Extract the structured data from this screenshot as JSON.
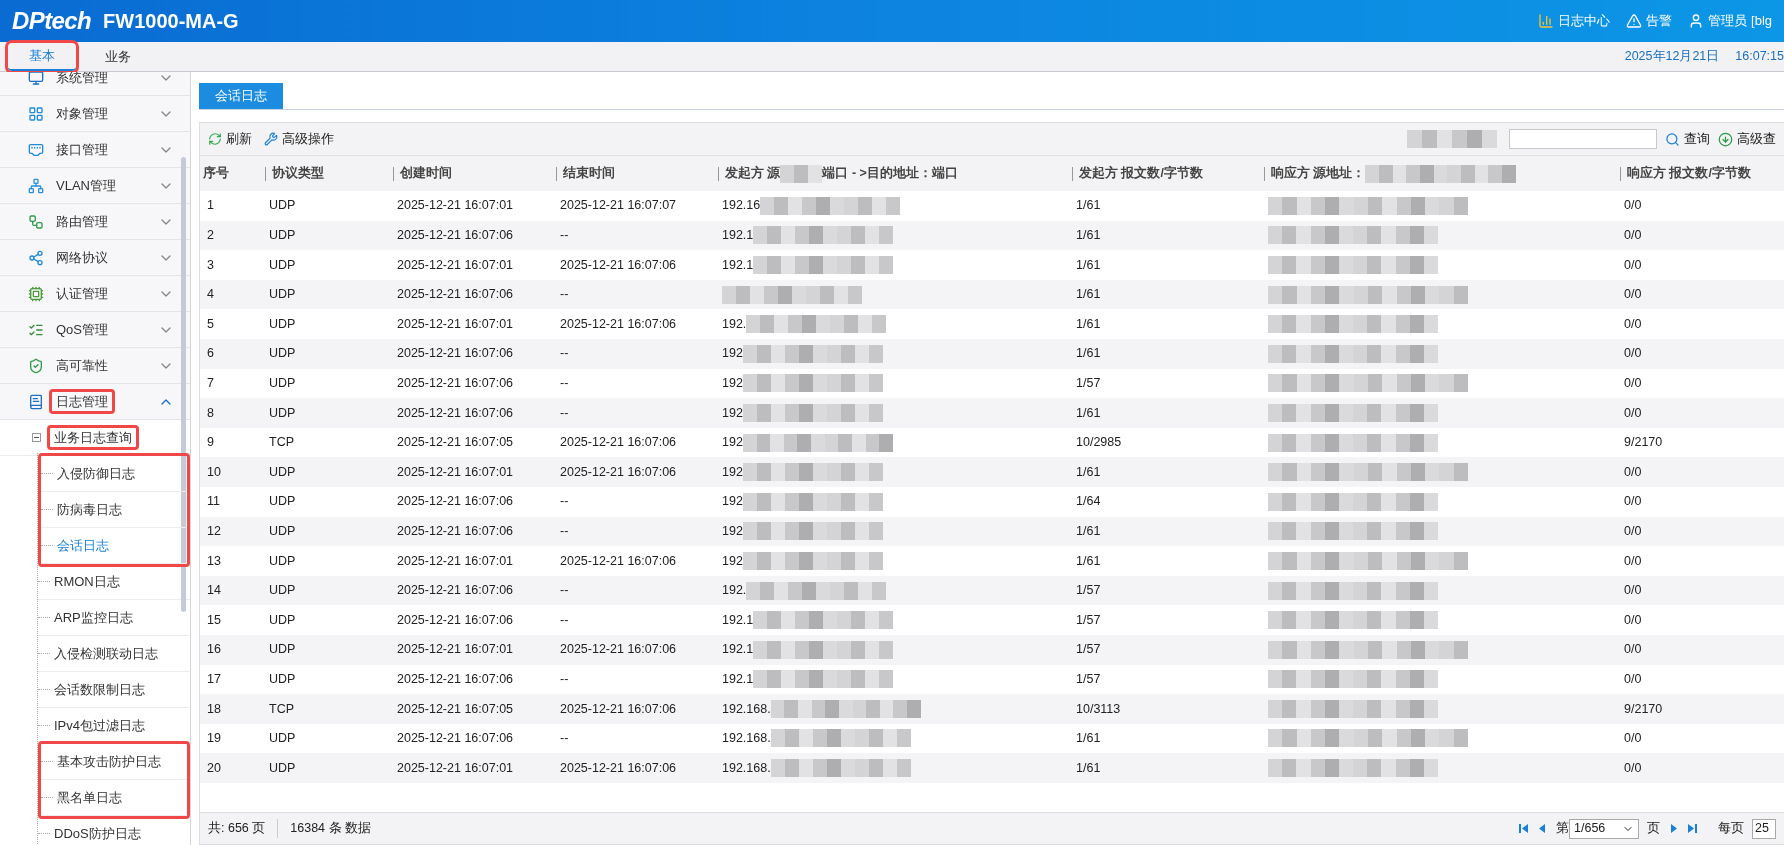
{
  "header": {
    "logo": "DPtech",
    "title": "FW1000-MA-G",
    "actions": [
      {
        "kind": "log",
        "label": "日志中心"
      },
      {
        "kind": "alarm",
        "label": "告警"
      },
      {
        "kind": "user",
        "label": "管理员 [blg"
      }
    ]
  },
  "top_tabs": [
    {
      "label": "基本",
      "selected": true,
      "highlighted": true
    },
    {
      "label": "业务",
      "selected": false,
      "highlighted": false
    }
  ],
  "datetime": {
    "date": "2025年12月21日",
    "time": "16:07:15"
  },
  "sidebar": {
    "items": [
      {
        "kind": "monitor",
        "label": "系统管理",
        "expanded": false,
        "highlighted": false
      },
      {
        "kind": "grid",
        "label": "对象管理",
        "expanded": false,
        "highlighted": false
      },
      {
        "kind": "port",
        "label": "接口管理",
        "expanded": false,
        "highlighted": false
      },
      {
        "kind": "vlan",
        "label": "VLAN管理",
        "expanded": false,
        "highlighted": false
      },
      {
        "kind": "route",
        "label": "路由管理",
        "expanded": false,
        "highlighted": false
      },
      {
        "kind": "network",
        "label": "网络协议",
        "expanded": false,
        "highlighted": false
      },
      {
        "kind": "auth",
        "label": "认证管理",
        "expanded": false,
        "highlighted": false
      },
      {
        "kind": "qos",
        "label": "QoS管理",
        "expanded": false,
        "highlighted": false
      },
      {
        "kind": "shield",
        "label": "高可靠性",
        "expanded": false,
        "highlighted": false
      },
      {
        "kind": "log",
        "label": "日志管理",
        "expanded": true,
        "highlighted": true,
        "children": [
          {
            "label": "业务日志查询",
            "expanded": true,
            "highlighted": true,
            "children": [
              {
                "label": "入侵防御日志",
                "selected": false,
                "highlighted": true
              },
              {
                "label": "防病毒日志",
                "selected": false,
                "highlighted": true
              },
              {
                "label": "会话日志",
                "selected": true,
                "highlighted": true
              },
              {
                "label": "RMON日志",
                "selected": false,
                "highlighted": false
              },
              {
                "label": "ARP监控日志",
                "selected": false,
                "highlighted": false
              },
              {
                "label": "入侵检测联动日志",
                "selected": false,
                "highlighted": false
              },
              {
                "label": "会话数限制日志",
                "selected": false,
                "highlighted": false
              },
              {
                "label": "IPv4包过滤日志",
                "selected": false,
                "highlighted": false
              },
              {
                "label": "基本攻击防护日志",
                "selected": false,
                "highlighted": true
              },
              {
                "label": "黑名单日志",
                "selected": false,
                "highlighted": true
              },
              {
                "label": "DDoS防护日志",
                "selected": false,
                "highlighted": false
              }
            ]
          }
        ]
      }
    ]
  },
  "page_tab": {
    "label": "会话日志",
    "selected": true
  },
  "toolbar": {
    "refresh": "刷新",
    "advanced_ops": "高级操作",
    "search_button": "查询",
    "advanced_search": "高级查"
  },
  "table": {
    "columns": [
      {
        "label": "序号"
      },
      {
        "label": "协议类型"
      },
      {
        "label": "创建时间"
      },
      {
        "label": "结束时间"
      },
      {
        "label": "发起方 源",
        "label_end": "端口 - >目的地址：端口"
      },
      {
        "label": "发起方 报文数/字节数"
      },
      {
        "label": "响应方 源地址："
      },
      {
        "label": "响应方 报文数/字节数"
      }
    ],
    "rows": [
      {
        "no": "1",
        "protocol": "UDP",
        "created": "2025-12-21 16:07:01",
        "ended": "2025-12-21 16:07:07",
        "initiator": "192.16",
        "initiator_counts": "1/61",
        "responder_counts": "0/0"
      },
      {
        "no": "2",
        "protocol": "UDP",
        "created": "2025-12-21 16:07:06",
        "ended": "--",
        "initiator": "192.1",
        "initiator_counts": "1/61",
        "responder_counts": "0/0"
      },
      {
        "no": "3",
        "protocol": "UDP",
        "created": "2025-12-21 16:07:01",
        "ended": "2025-12-21 16:07:06",
        "initiator": "192.1",
        "initiator_counts": "1/61",
        "responder_counts": "0/0"
      },
      {
        "no": "4",
        "protocol": "UDP",
        "created": "2025-12-21 16:07:06",
        "ended": "--",
        "initiator_counts": "1/61",
        "responder_counts": "0/0"
      },
      {
        "no": "5",
        "protocol": "UDP",
        "created": "2025-12-21 16:07:01",
        "ended": "2025-12-21 16:07:06",
        "initiator": "192.",
        "initiator_counts": "1/61",
        "responder_counts": "0/0"
      },
      {
        "no": "6",
        "protocol": "UDP",
        "created": "2025-12-21 16:07:06",
        "ended": "--",
        "initiator": "192",
        "initiator_counts": "1/61",
        "responder_counts": "0/0"
      },
      {
        "no": "7",
        "protocol": "UDP",
        "created": "2025-12-21 16:07:06",
        "ended": "--",
        "initiator": "192",
        "initiator_counts": "1/57",
        "responder_counts": "0/0"
      },
      {
        "no": "8",
        "protocol": "UDP",
        "created": "2025-12-21 16:07:06",
        "ended": "--",
        "initiator": "192",
        "initiator_counts": "1/61",
        "responder_counts": "0/0"
      },
      {
        "no": "9",
        "protocol": "TCP",
        "created": "2025-12-21 16:07:05",
        "ended": "2025-12-21 16:07:06",
        "initiator": "192",
        "initiator_counts": "10/2985",
        "responder_counts": "9/2170"
      },
      {
        "no": "10",
        "protocol": "UDP",
        "created": "2025-12-21 16:07:01",
        "ended": "2025-12-21 16:07:06",
        "initiator": "192",
        "initiator_counts": "1/61",
        "responder_counts": "0/0"
      },
      {
        "no": "11",
        "protocol": "UDP",
        "created": "2025-12-21 16:07:06",
        "ended": "--",
        "initiator": "192",
        "initiator_counts": "1/64",
        "responder_counts": "0/0"
      },
      {
        "no": "12",
        "protocol": "UDP",
        "created": "2025-12-21 16:07:06",
        "ended": "--",
        "initiator": "192",
        "initiator_counts": "1/61",
        "responder_counts": "0/0"
      },
      {
        "no": "13",
        "protocol": "UDP",
        "created": "2025-12-21 16:07:01",
        "ended": "2025-12-21 16:07:06",
        "initiator": "192",
        "initiator_counts": "1/61",
        "responder_counts": "0/0"
      },
      {
        "no": "14",
        "protocol": "UDP",
        "created": "2025-12-21 16:07:06",
        "ended": "--",
        "initiator": "192.",
        "initiator_counts": "1/57",
        "responder_counts": "0/0"
      },
      {
        "no": "15",
        "protocol": "UDP",
        "created": "2025-12-21 16:07:06",
        "ended": "--",
        "initiator": "192.1",
        "initiator_counts": "1/57",
        "responder_counts": "0/0"
      },
      {
        "no": "16",
        "protocol": "UDP",
        "created": "2025-12-21 16:07:01",
        "ended": "2025-12-21 16:07:06",
        "initiator": "192.1",
        "initiator_counts": "1/57",
        "responder_counts": "0/0"
      },
      {
        "no": "17",
        "protocol": "UDP",
        "created": "2025-12-21 16:07:06",
        "ended": "--",
        "initiator": "192.1",
        "initiator_counts": "1/57",
        "responder_counts": "0/0"
      },
      {
        "no": "18",
        "protocol": "TCP",
        "created": "2025-12-21 16:07:05",
        "ended": "2025-12-21 16:07:06",
        "initiator": "192.168.",
        "initiator_counts": "10/3113",
        "responder_counts": "9/2170"
      },
      {
        "no": "19",
        "protocol": "UDP",
        "created": "2025-12-21 16:07:06",
        "ended": "--",
        "initiator": "192.168.",
        "initiator_counts": "1/61",
        "responder_counts": "0/0"
      },
      {
        "no": "20",
        "protocol": "UDP",
        "created": "2025-12-21 16:07:01",
        "ended": "2025-12-21 16:07:06",
        "initiator": "192.168.",
        "initiator_counts": "1/61",
        "responder_counts": "0/0"
      }
    ]
  },
  "footer": {
    "pages": "共: 656 页",
    "records": "16384 条 数据",
    "page_prefix": "第",
    "page_value": "1/656",
    "page_suffix": "页",
    "per_page_label": "每页",
    "per_page_value": "25"
  }
}
